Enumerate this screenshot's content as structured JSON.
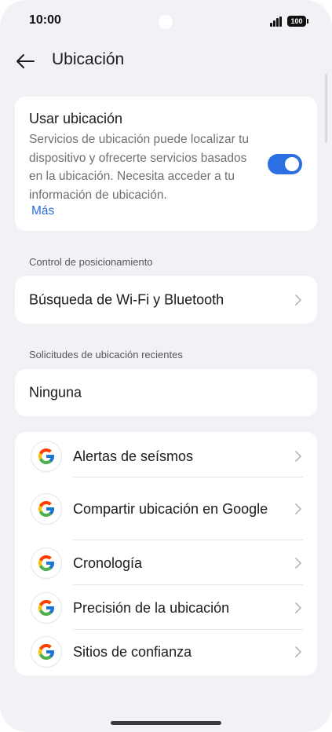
{
  "status_bar": {
    "time": "10:00",
    "battery": "100"
  },
  "header": {
    "title": "Ubicación",
    "back_icon": "arrow-left-icon"
  },
  "location_card": {
    "title": "Usar ubicación",
    "description": "Servicios de ubicación puede localizar tu dispositivo y ofrecerte servicios basados en la ubicación. Necesita acceder a tu información de ubicación.",
    "more_link": "Más",
    "toggle_on": true,
    "accent_color": "#2b6fe3"
  },
  "positioning_section": {
    "label": "Control de posicionamiento",
    "item": "Búsqueda de Wi-Fi y Bluetooth"
  },
  "recent_requests_section": {
    "label": "Solicitudes de ubicación recientes",
    "item": "Ninguna"
  },
  "google_services": {
    "icon": "google-g-icon",
    "items": [
      "Alertas de seísmos",
      "Compartir ubicación en Google",
      "Cronología",
      "Precisión de la ubicación",
      "Sitios de confianza"
    ]
  }
}
